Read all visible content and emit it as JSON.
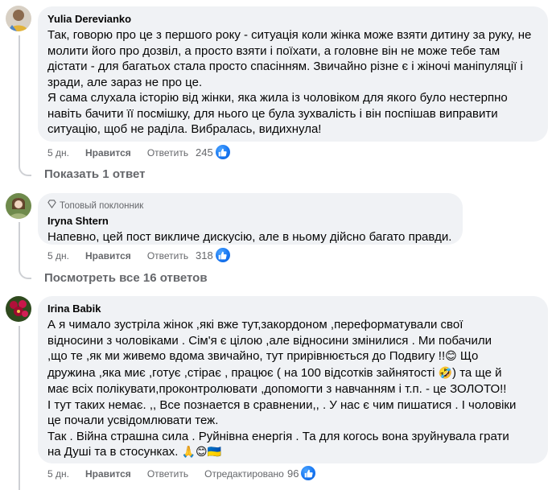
{
  "comments": [
    {
      "author": "Yulia Derevianko",
      "paragraphs": [
        "Так, говорю про це з першого року - ситуація коли жінка може взяти дитину за руку, не молити його про дозвіл, а просто взяти і поїхати, а головне він не може тебе там дістати - для багатьох стала просто спасінням. Звичайно різне є і жіночі маніпуляції і зради, але зараз не про це.",
        "Я сама слухала історію від жінки, яка жила із чоловіком для якого було нестерпно навіть бачити її посмішку, для нього це була зухвалість і він поспішав виправити ситуацію, щоб не раділа. Вибралась, видихнула!"
      ],
      "time": "5 дн.",
      "like": "Нравится",
      "reply": "Ответить",
      "reactions": "245",
      "more_replies": "Показать 1 ответ"
    },
    {
      "badge": "Топовый поклонник",
      "author": "Iryna Shtern",
      "paragraphs": [
        "Напевно, цей пост викличе дискусію, але в ньому дійсно багато правди."
      ],
      "time": "5 дн.",
      "like": "Нравится",
      "reply": "Ответить",
      "reactions": "318",
      "more_replies": "Посмотреть все 16 ответов"
    },
    {
      "author": "Irina Babik",
      "lines": [
        "А я чимало зустріла жінок ,які вже тут,закордоном ,переформатували свої",
        "відносини з чоловіками . Сім'я є цілою ,але відносини змінилися . Ми побачили",
        ",що те ,як ми живемо вдома звичайно, тут прирівнюється до Подвигу !!",
        "дружина ,яка миє ,готує ,стірає , працює ( на 100 відсотків зайнятості",
        "має всіх полікувати,проконтролювати ,допомогти з навчанням і т.п. - це ЗОЛОТО!!",
        "І тут таких немає. ,, Все познается в сравнении,, . У нас є чим пишатися . І чоловіки",
        "це почали усвідомлювати теж.",
        "Так . Війна страшна сила . Руйнівна енергія . Та для когось вона зруйнувала грати",
        "на Душі та в стосунках."
      ],
      "line3_tail": "Що",
      "line4_tail": "та ще й",
      "emoji_smile": "😊",
      "emoji_sweat": "🤣",
      "emoji_end": "🙏😊🇺🇦",
      "time": "5 дн.",
      "like": "Нравится",
      "reply": "Ответить",
      "translate": "Отредактировано",
      "reactions": "96"
    }
  ],
  "icons": {
    "like": "thumbs-up-icon",
    "badge": "diamond-icon"
  },
  "colors": {
    "bubble": "#f0f2f5",
    "like_blue": "#1877f2",
    "secondary_text": "#65676b"
  }
}
